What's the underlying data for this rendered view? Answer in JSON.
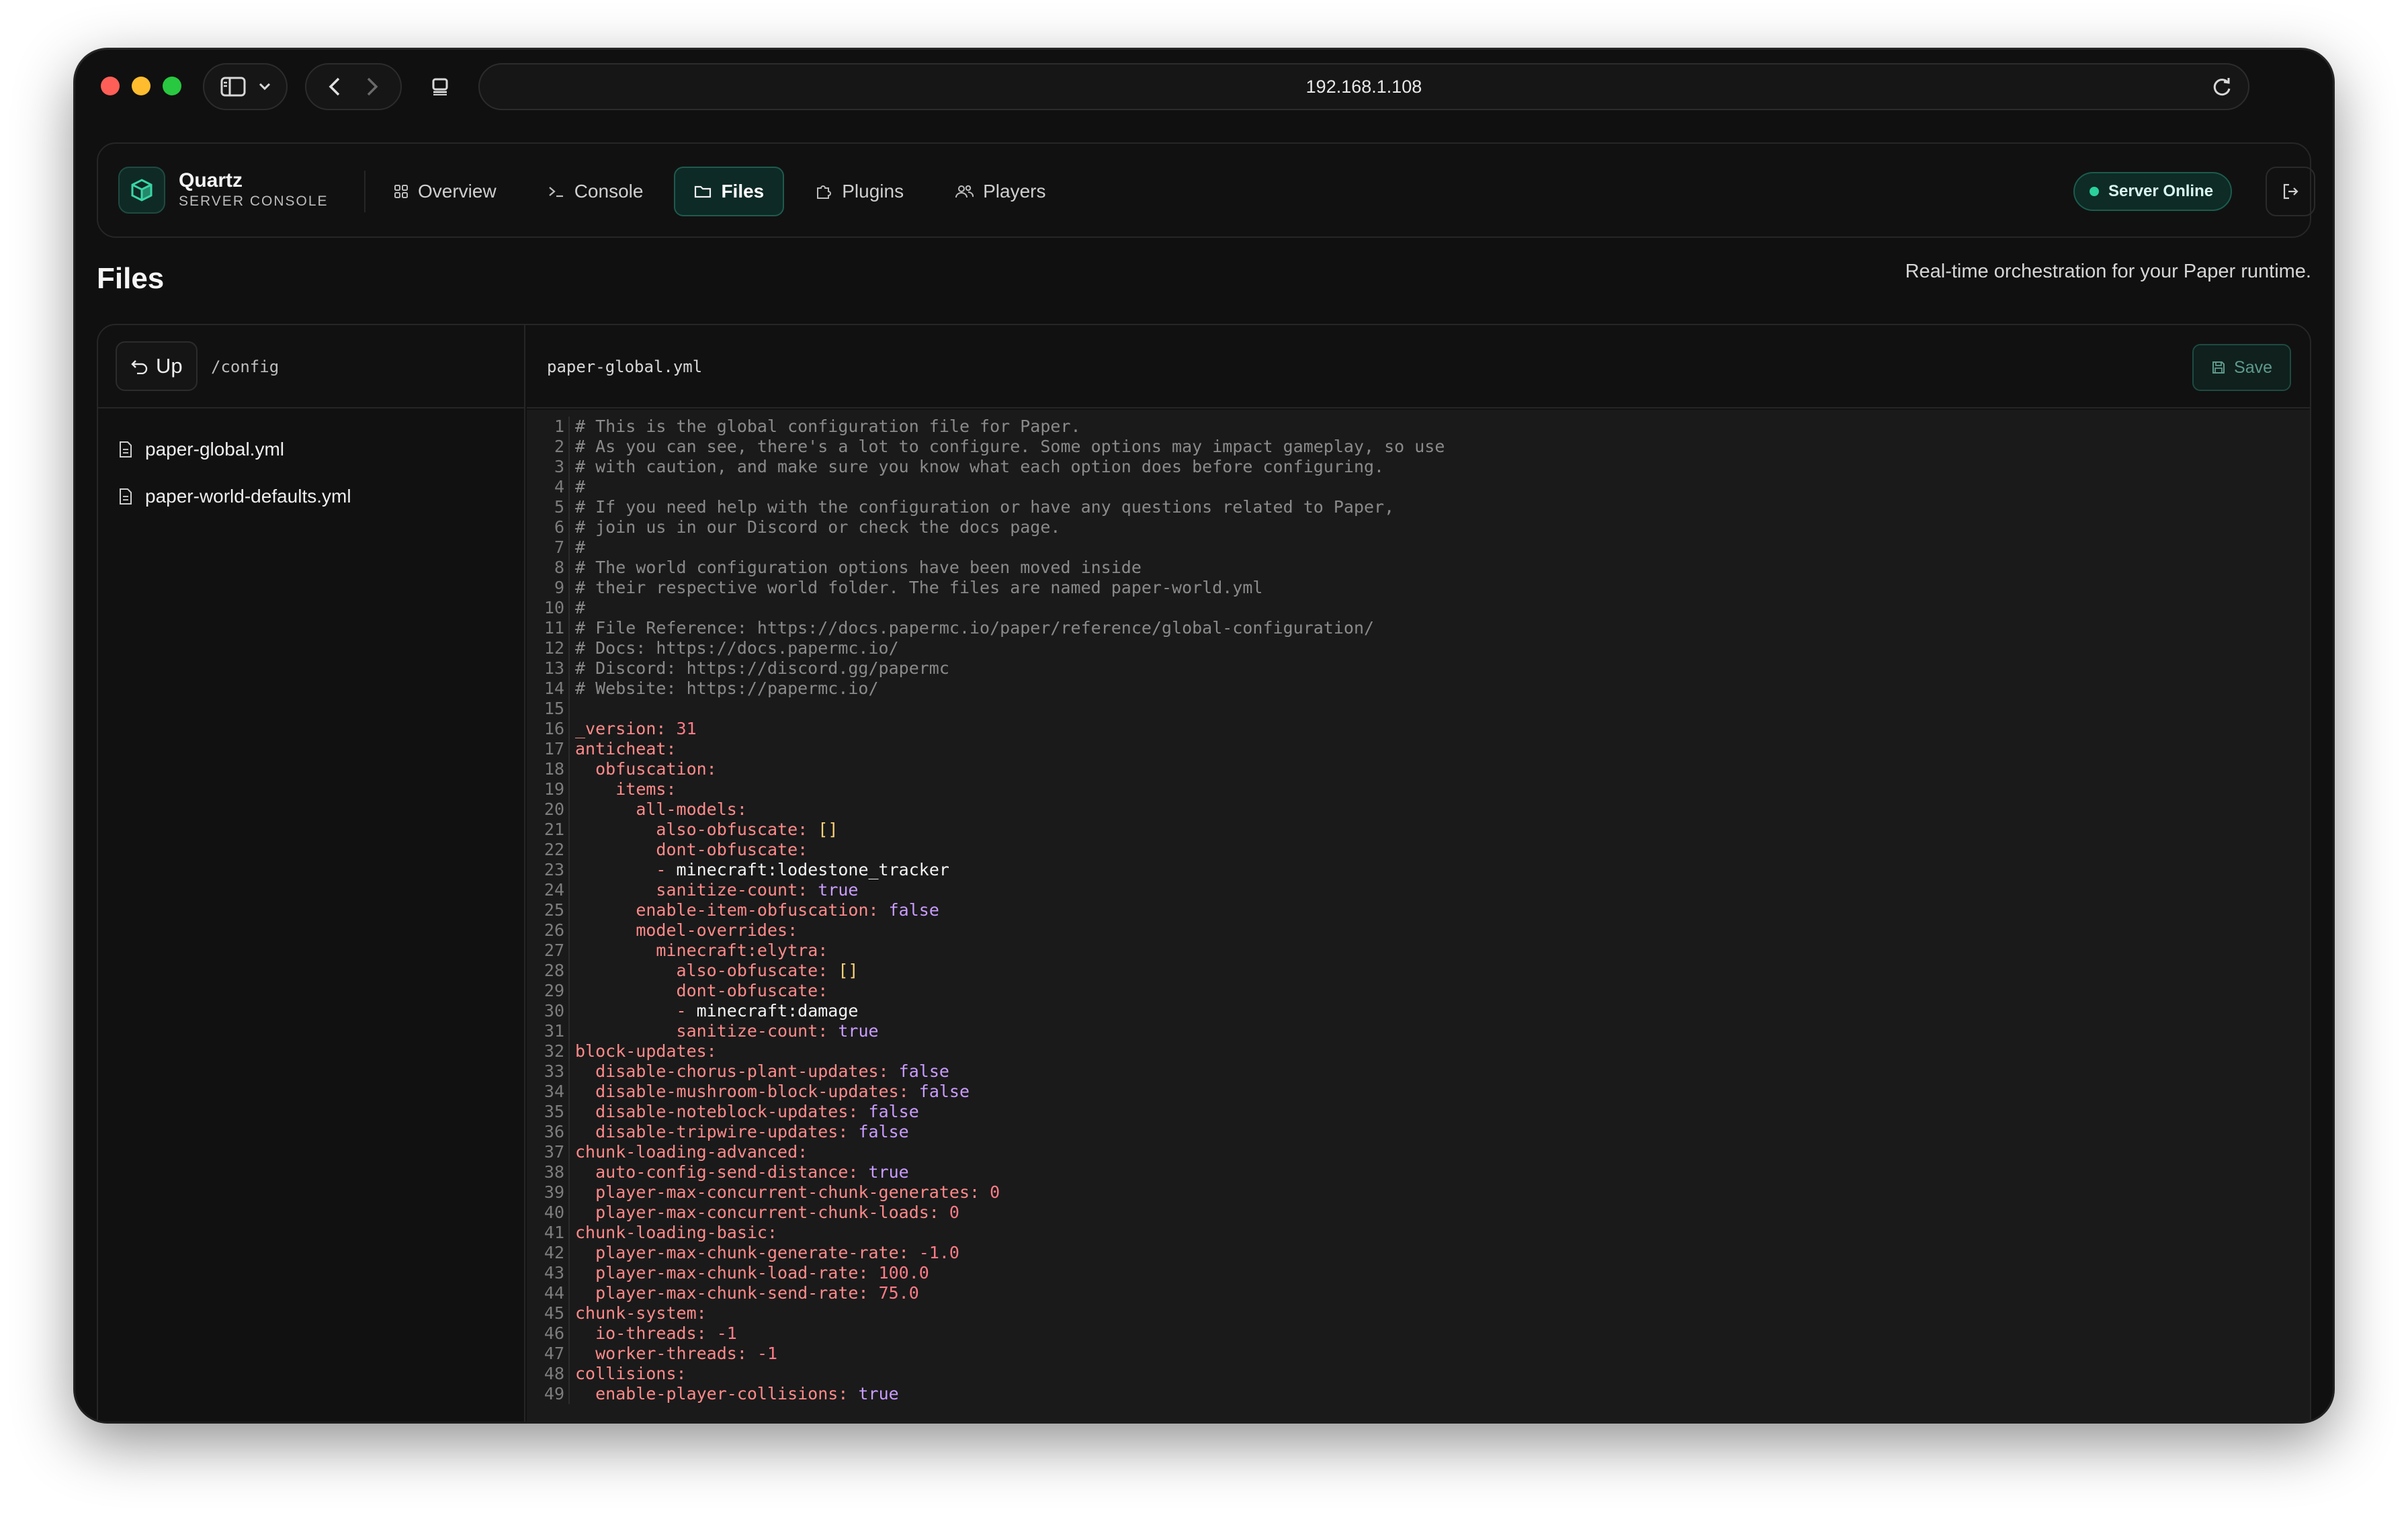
{
  "browser": {
    "url": "192.168.1.108"
  },
  "app": {
    "brand_name": "Quartz",
    "brand_sub": "SERVER CONSOLE",
    "nav": [
      {
        "label": "Overview",
        "icon": "grid-icon",
        "active": false
      },
      {
        "label": "Console",
        "icon": "terminal-icon",
        "active": false
      },
      {
        "label": "Files",
        "icon": "folder-icon",
        "active": true
      },
      {
        "label": "Plugins",
        "icon": "puzzle-icon",
        "active": false
      },
      {
        "label": "Players",
        "icon": "users-icon",
        "active": false
      }
    ],
    "status": "Server Online",
    "status_color": "#2ad19a"
  },
  "page": {
    "title": "Files",
    "subtitle": "Real-time orchestration for your Paper runtime."
  },
  "browser_panel": {
    "up_label": "Up",
    "cwd": "/config",
    "files": [
      "paper-global.yml",
      "paper-world-defaults.yml"
    ]
  },
  "editor": {
    "filename": "paper-global.yml",
    "save_label": "Save",
    "lines": [
      "# This is the global configuration file for Paper.",
      "# As you can see, there's a lot to configure. Some options may impact gameplay, so use",
      "# with caution, and make sure you know what each option does before configuring.",
      "#",
      "# If you need help with the configuration or have any questions related to Paper,",
      "# join us in our Discord or check the docs page.",
      "#",
      "# The world configuration options have been moved inside",
      "# their respective world folder. The files are named paper-world.yml",
      "#",
      "# File Reference: https://docs.papermc.io/paper/reference/global-configuration/",
      "# Docs: https://docs.papermc.io/",
      "# Discord: https://discord.gg/papermc",
      "# Website: https://papermc.io/",
      "",
      "_version: 31",
      "anticheat:",
      "  obfuscation:",
      "    items:",
      "      all-models:",
      "        also-obfuscate: []",
      "        dont-obfuscate:",
      "        - minecraft:lodestone_tracker",
      "        sanitize-count: true",
      "      enable-item-obfuscation: false",
      "      model-overrides:",
      "        minecraft:elytra:",
      "          also-obfuscate: []",
      "          dont-obfuscate:",
      "          - minecraft:damage",
      "          sanitize-count: true",
      "block-updates:",
      "  disable-chorus-plant-updates: false",
      "  disable-mushroom-block-updates: false",
      "  disable-noteblock-updates: false",
      "  disable-tripwire-updates: false",
      "chunk-loading-advanced:",
      "  auto-config-send-distance: true",
      "  player-max-concurrent-chunk-generates: 0",
      "  player-max-concurrent-chunk-loads: 0",
      "chunk-loading-basic:",
      "  player-max-chunk-generate-rate: -1.0",
      "  player-max-chunk-load-rate: 100.0",
      "  player-max-chunk-send-rate: 75.0",
      "chunk-system:",
      "  io-threads: -1",
      "  worker-threads: -1",
      "collisions:",
      "  enable-player-collisions: true"
    ]
  }
}
